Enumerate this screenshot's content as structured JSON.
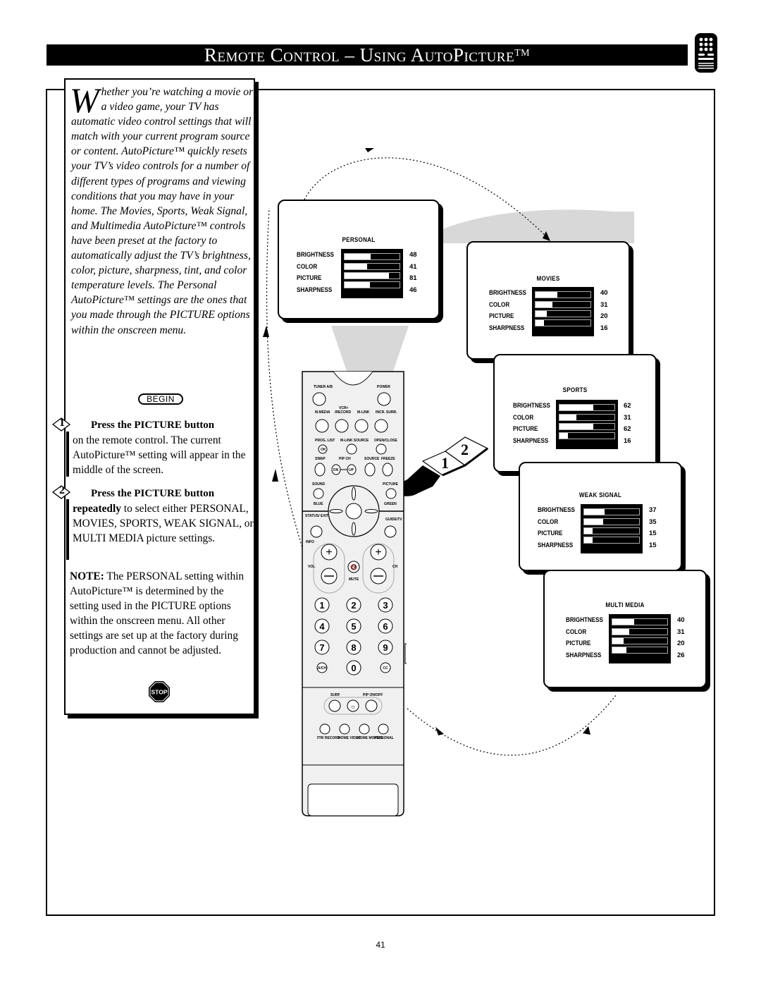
{
  "header": {
    "title": "Remote Control – Using AutoPicture",
    "title_tm": "TM",
    "icon": "remote-control-icon"
  },
  "intro": {
    "dropcap": "W",
    "text": "hether you’re watching a movie or a video game, your TV has automatic video control settings that will match with your current program source or content. AutoPicture™ quickly resets your TV’s video controls for a number of different types of programs and viewing conditions that you may have in your home. The Movies, Sports, Weak Signal, and Multimedia AutoPicture™ controls have been preset at the factory to automatically adjust the TV’s brightness, color, picture, sharpness, tint, and color temperature levels. The Personal AutoPicture™ settings are the ones that you made through the PICTURE options within the onscreen menu."
  },
  "begin_label": "BEGIN",
  "steps": [
    {
      "number": "1",
      "title": "Press the PICTURE button",
      "text_pre": "",
      "text": " on the remote control.  The current AutoPicture™ setting will appear in the middle of the screen."
    },
    {
      "number": "2",
      "title": "Press the PICTURE button",
      "text_pre": "repeatedly",
      "text": " to select either PERSONAL, MOVIES, SPORTS, WEAK SIGNAL, or MULTI MEDIA picture settings."
    }
  ],
  "note": {
    "label": "NOTE:",
    "text": "  The PERSONAL setting within AutoPicture™ is determined by the setting used in the PICTURE options within the onscreen menu. All other settings are set up at the factory during production and cannot be adjusted."
  },
  "stop_label": "STOP",
  "screens": [
    {
      "title": "PERSONAL",
      "settings": [
        {
          "label": "BRIGHTNESS",
          "value": 48
        },
        {
          "label": "COLOR",
          "value": 41
        },
        {
          "label": "PICTURE",
          "value": 81
        },
        {
          "label": "SHARPNESS",
          "value": 46
        }
      ]
    },
    {
      "title": "MOVIES",
      "settings": [
        {
          "label": "BRIGHTNESS",
          "value": 40
        },
        {
          "label": "COLOR",
          "value": 31
        },
        {
          "label": "PICTURE",
          "value": 20
        },
        {
          "label": "SHARPNESS",
          "value": 16
        }
      ]
    },
    {
      "title": "SPORTS",
      "settings": [
        {
          "label": "BRIGHTNESS",
          "value": 62
        },
        {
          "label": "COLOR",
          "value": 31
        },
        {
          "label": "PICTURE",
          "value": 62
        },
        {
          "label": "SHARPNESS",
          "value": 16
        }
      ]
    },
    {
      "title": "WEAK SIGNAL",
      "settings": [
        {
          "label": "BRIGHTNESS",
          "value": 37
        },
        {
          "label": "COLOR",
          "value": 35
        },
        {
          "label": "PICTURE",
          "value": 15
        },
        {
          "label": "SHARPNESS",
          "value": 15
        }
      ]
    },
    {
      "title": "MULTI MEDIA",
      "settings": [
        {
          "label": "BRIGHTNESS",
          "value": 40
        },
        {
          "label": "COLOR",
          "value": 31
        },
        {
          "label": "PICTURE",
          "value": 20
        },
        {
          "label": "SHARPNESS",
          "value": 26
        }
      ]
    }
  ],
  "callout_steps": [
    "1",
    "2"
  ],
  "remote": {
    "labels": {
      "tuner": "TUNER A/B",
      "power": "POWER",
      "vcr": "VCR+",
      "record": "/RECORD",
      "mmedia": "M.MEDIA",
      "mlink": "M-LINK",
      "incr_surr": "INCR. SURR.",
      "prog_list": "PROG. LIST",
      "mlink_source": "M-LINK SOURCE",
      "open_close": "OPEN/CLOSE",
      "ok": "OK",
      "swap": "SWAP",
      "pip_ch": "PIP CH",
      "source": "SOURCE",
      "freeze": "FREEZE",
      "dn": "DN",
      "up": "UP",
      "sound": "SOUND",
      "picture": "PICTURE",
      "blue": "BLUE",
      "green": "GREEN",
      "status_exit": "STATUS/ EXIT",
      "guide_tv": "GUIDE/TV",
      "info": "INFO",
      "vol": "VOL",
      "ch": "CH",
      "mute": "MUTE",
      "digits": [
        "1",
        "2",
        "3",
        "4",
        "5",
        "6",
        "7",
        "8",
        "9"
      ],
      "ach": "A/CH",
      "zero": "0",
      "cc": "CC",
      "surf": "SURF",
      "pip_onoff": "PIP ON/OFF",
      "itr_record": "ITR/ RECORD",
      "home_video": "HOME VIDEO",
      "home_movies": "HOME MOVIES",
      "personal": "PERSONAL"
    }
  },
  "page_number": "41"
}
